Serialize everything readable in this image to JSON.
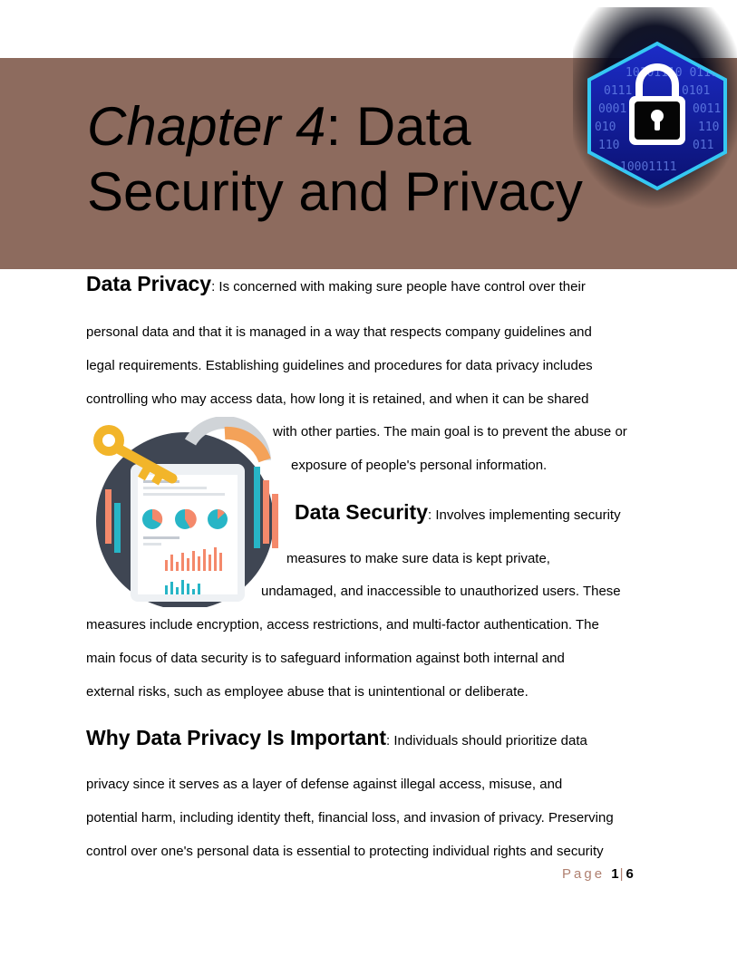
{
  "chapter": {
    "number_label": "Chapter 4",
    "title_rest_1": ": Data",
    "title_line_2": "Security and Privacy"
  },
  "badge": {
    "icon": "padlock-binary-hexagon-icon",
    "binary_text": "10101110 0110 0101 0001 1010 0011 010 110 011 10001111"
  },
  "sections": {
    "privacy": {
      "heading": "Data Privacy",
      "lines": [
        ": Is concerned with making sure people have control over their",
        "personal data and that it is managed in a way that respects company guidelines and",
        "legal requirements. Establishing guidelines and procedures for data privacy includes",
        "controlling who may access data, how long it is retained, and when it can be shared",
        "with other parties. The main goal is to prevent the abuse or",
        "exposure of people's personal information."
      ]
    },
    "security": {
      "heading": "Data Security",
      "lines": [
        ": Involves implementing security",
        "measures to make sure data is kept private,",
        "undamaged, and inaccessible to unauthorized users. These",
        "measures include encryption, access restrictions, and multi-factor authentication. The",
        "main focus of data security is to safeguard information against both internal and",
        "external risks, such as employee abuse that is unintentional or deliberate."
      ]
    },
    "importance": {
      "heading": "Why Data Privacy Is Important",
      "lines": [
        ": Individuals should prioritize data",
        "privacy since it serves as a layer of defense against illegal access, misuse, and",
        "potential harm, including identity theft, financial loss, and invasion of privacy. Preserving",
        "control over one's personal data is essential to protecting individual rights and security"
      ]
    }
  },
  "illustration": {
    "icon": "data-report-key-lock-icon"
  },
  "footer": {
    "page_word": "Page",
    "current": "1",
    "separator": "|",
    "total": "6"
  }
}
